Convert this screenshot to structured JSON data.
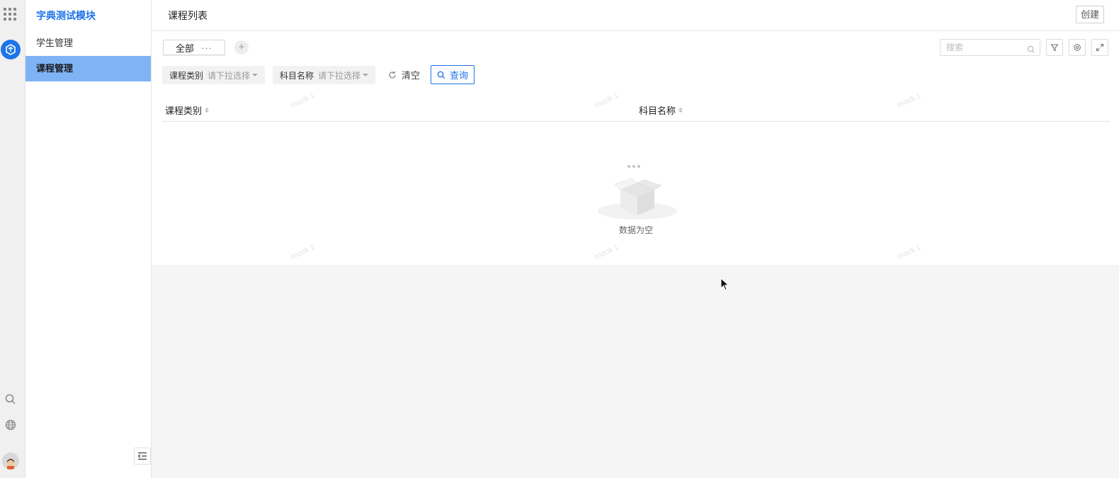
{
  "sidebar": {
    "module_title": "字典测试模块",
    "items": [
      {
        "label": "学生管理",
        "active": false
      },
      {
        "label": "课程管理",
        "active": true
      }
    ]
  },
  "header": {
    "title": "课程列表",
    "create_label": "创建"
  },
  "toolbar": {
    "view_tab_label": "全部",
    "view_tab_more": "···",
    "add_view_label": "+",
    "search_placeholder": "搜索"
  },
  "filters": [
    {
      "label": "课程类别",
      "placeholder": "请下拉选择"
    },
    {
      "label": "科目名称",
      "placeholder": "请下拉选择"
    }
  ],
  "actions": {
    "clear_label": "清空",
    "query_label": "查询"
  },
  "table": {
    "columns": [
      "课程类别",
      "科目名称"
    ],
    "rows": [],
    "empty_text": "数据为空"
  },
  "watermark": "mock 1",
  "colors": {
    "accent": "#1e74e8",
    "active_item_bg": "#7fb3f6"
  },
  "icons": {
    "rail": [
      "app-grid-icon",
      "app-logo-icon",
      "search-icon",
      "globe-icon",
      "avatar"
    ],
    "toolbar": [
      "search-icon",
      "filter-icon",
      "settings-icon",
      "fullscreen-icon"
    ],
    "collapse": "collapse-sidebar-icon"
  }
}
